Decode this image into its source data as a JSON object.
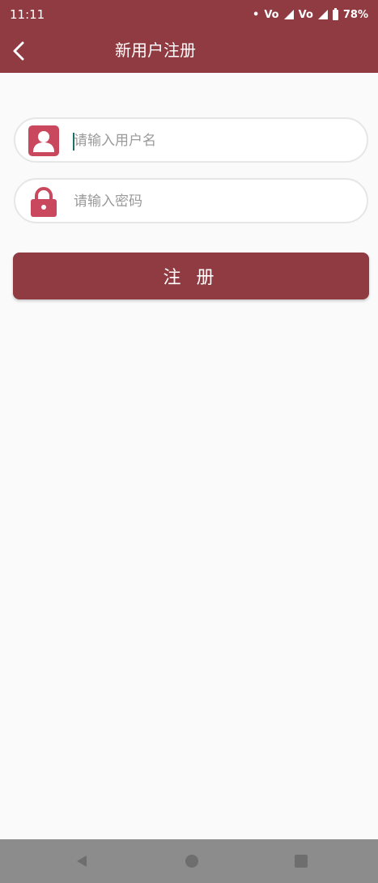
{
  "status": {
    "time": "11:11",
    "dot": "•",
    "volte1": "Vo",
    "volte2": "Vo",
    "battery": "78%"
  },
  "appbar": {
    "title": "新用户注册"
  },
  "form": {
    "username_placeholder": "请输入用户名",
    "password_placeholder": "请输入密码",
    "register_label": "注 册"
  },
  "colors": {
    "primary": "#8f3b41",
    "icon": "#c9485e",
    "background": "#fafafa"
  },
  "icons": {
    "back": "chevron-left-icon",
    "user": "user-icon",
    "lock": "lock-icon"
  }
}
